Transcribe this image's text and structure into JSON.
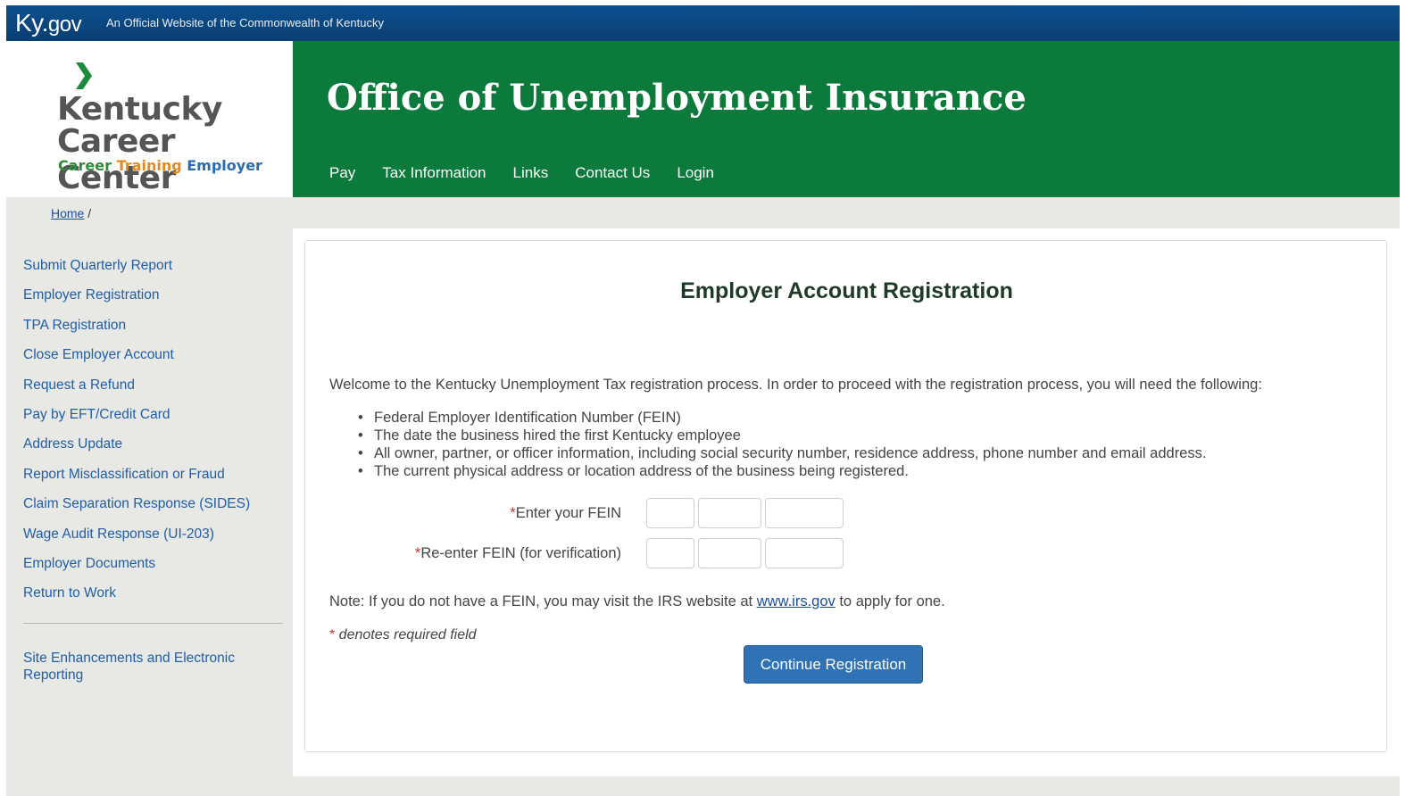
{
  "kygov": {
    "logo_main": "Ky.",
    "logo_tld": "gov",
    "official_text": "An Official Website of the Commonwealth of Kentucky"
  },
  "brand": {
    "line1": "Kentucky",
    "line2": "Career Center",
    "tag1": "Career",
    "tag2": "Training",
    "tag3": "Employer",
    "colors": {
      "green": "#2e8b3a",
      "orange": "#e58a1f",
      "blue": "#2c6db1"
    }
  },
  "header": {
    "title": "Office of Unemployment Insurance",
    "nav": [
      "Pay",
      "Tax Information",
      "Links",
      "Contact Us",
      "Login"
    ],
    "color": "#0c7a3a"
  },
  "breadcrumb": {
    "home": "Home",
    "sep": " /"
  },
  "sidebar": {
    "items": [
      "Submit Quarterly Report",
      "Employer Registration",
      "TPA Registration",
      "Close Employer Account",
      "Request a Refund",
      "Pay by EFT/Credit Card",
      "Address Update",
      "Report Misclassification or Fraud",
      "Claim Separation Response (SIDES)",
      "Wage Audit Response (UI-203)",
      "Employer Documents",
      "Return to Work"
    ],
    "extra": "Site Enhancements and Electronic Reporting"
  },
  "form": {
    "heading": "Employer Account Registration",
    "intro": "Welcome to the Kentucky Unemployment Tax registration process. In order to proceed with the registration process, you will need the following:",
    "requirements": [
      "Federal Employer Identification Number (FEIN)",
      "The date the business hired the first Kentucky employee",
      "All owner, partner, or officer information, including social security number, residence address, phone number and email address.",
      "The current physical address or location address of the business being registered."
    ],
    "fein_label": "Enter your FEIN",
    "fein_verify_label": "Re-enter FEIN (for verification)",
    "star": "*",
    "fein_values": [
      "",
      "",
      ""
    ],
    "fein_verify_values": [
      "",
      "",
      ""
    ],
    "note_prefix": "Note: If you do not have a FEIN, you may visit the IRS website at ",
    "note_link": "www.irs.gov",
    "note_suffix": " to apply for one.",
    "required_note": " denotes required field",
    "submit_label": "Continue Registration",
    "button_color": "#2f73b6"
  }
}
